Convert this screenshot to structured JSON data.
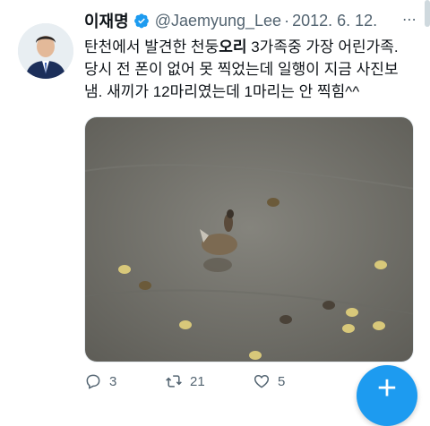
{
  "tweet": {
    "author_name": "이재명",
    "handle": "@Jaemyung_Lee",
    "separator": "·",
    "date": "2012. 6. 12.",
    "text_line1_a": "탄천에서 발견한 천둥",
    "text_line1_bold": "오리",
    "text_line1_b": " 3가족중 가장 어린가족.",
    "text_line2": "당시 전 폰이 없어 못 찍었는데 일행이 지금 사진보",
    "text_line3": "냄. 새끼가 12마리였는데 1마리는 안 찍힘^^",
    "more_label": "⋯",
    "replies": "3",
    "retweets": "21",
    "likes": "5"
  },
  "colors": {
    "accent": "#1d9bf0",
    "secondary_text": "#536471",
    "water": "#6f6e68"
  },
  "icons": {
    "verified": "verified-badge-icon",
    "reply": "reply-icon",
    "retweet": "retweet-icon",
    "like": "heart-icon",
    "compose": "plus-icon"
  },
  "compose_button": {
    "label": "+"
  }
}
